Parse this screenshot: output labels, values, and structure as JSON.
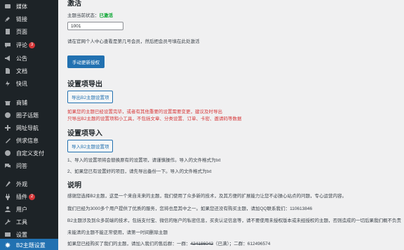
{
  "sidebar": {
    "items": [
      {
        "label": "媒体",
        "icon": "media-icon"
      },
      {
        "label": "链接",
        "icon": "link-icon"
      },
      {
        "label": "页面",
        "icon": "page-icon"
      },
      {
        "label": "评论",
        "icon": "comment-icon",
        "badge": "3"
      },
      {
        "label": "公告",
        "icon": "megaphone-icon"
      },
      {
        "label": "文档",
        "icon": "document-icon"
      },
      {
        "label": "快讯",
        "icon": "flash-icon"
      },
      {
        "label": "商铺",
        "icon": "store-icon"
      },
      {
        "label": "圈子话题",
        "icon": "circle-icon"
      },
      {
        "label": "网址导航",
        "icon": "globe-icon"
      },
      {
        "label": "供求信息",
        "icon": "supply-icon"
      },
      {
        "label": "自定义支付",
        "icon": "pay-icon"
      },
      {
        "label": "问答",
        "icon": "qa-icon"
      },
      {
        "label": "外观",
        "icon": "appearance-icon"
      },
      {
        "label": "插件",
        "icon": "plugin-icon",
        "badge": "2"
      },
      {
        "label": "用户",
        "icon": "user-icon"
      },
      {
        "label": "工具",
        "icon": "tool-icon"
      },
      {
        "label": "设置",
        "icon": "settings-icon"
      },
      {
        "label": "B2主题设置",
        "icon": "b2-icon",
        "active": true
      }
    ]
  },
  "activation": {
    "title": "激活",
    "status_label": "主题当前状态：",
    "status_value": "已激活",
    "input_value": "1001",
    "hint": "请在官网个人中心查看是第几号会员，然后把会员号填在此处激活",
    "update_button": "手动更新授权"
  },
  "export": {
    "title": "设置项导出",
    "button": "导出B2主题设置项",
    "warn1": "如果您的主题已经设置完毕，或者有其他重要的设置需要变更，建议及时导出",
    "warn2": "只导出B2主题的设置项和小工具，不包括文章、分类设置、订单、卡密、邀请码等数据"
  },
  "import": {
    "title": "设置项导入",
    "button": "导入B2主题设置项",
    "note1": "1、导入的设置项将会替换原有的设置项，请谨慎操作。导入的文件格式为txt",
    "note2": "2、如果您已有设置好的项目，请先导出备份一下。导入的文件格式为txt"
  },
  "about": {
    "title": "说明",
    "p1": "感谢您选择B2主题，这是一个来自未来的主题，我们使用了众多新的技术，及其方便的扩展能力让您不必操心站点的问题，专心运营内容。",
    "p2": "我们已经为3000多个用户提供了优质的服务，您将也是其中之一。如果您还没有购买主题，请加QQ联系我们：110613846",
    "p3": "B2主题涉及到众多前端的技术，包括支付宝、微信的账户的私密信息，买卖认证信息等，请不要使用未授权版本或未经授权的主题，否则造成的一切后果我们概不负责",
    "p4": "未能清的主题不能正常使用，请第一时间删除主题",
    "p5_prefix": "如果您已经购买了我们的主题，请加入我们的售后群：一群：",
    "p5_group1": "424186042",
    "p5_group1_note": "（已满）；二群：",
    "p5_group2": "612496574"
  }
}
